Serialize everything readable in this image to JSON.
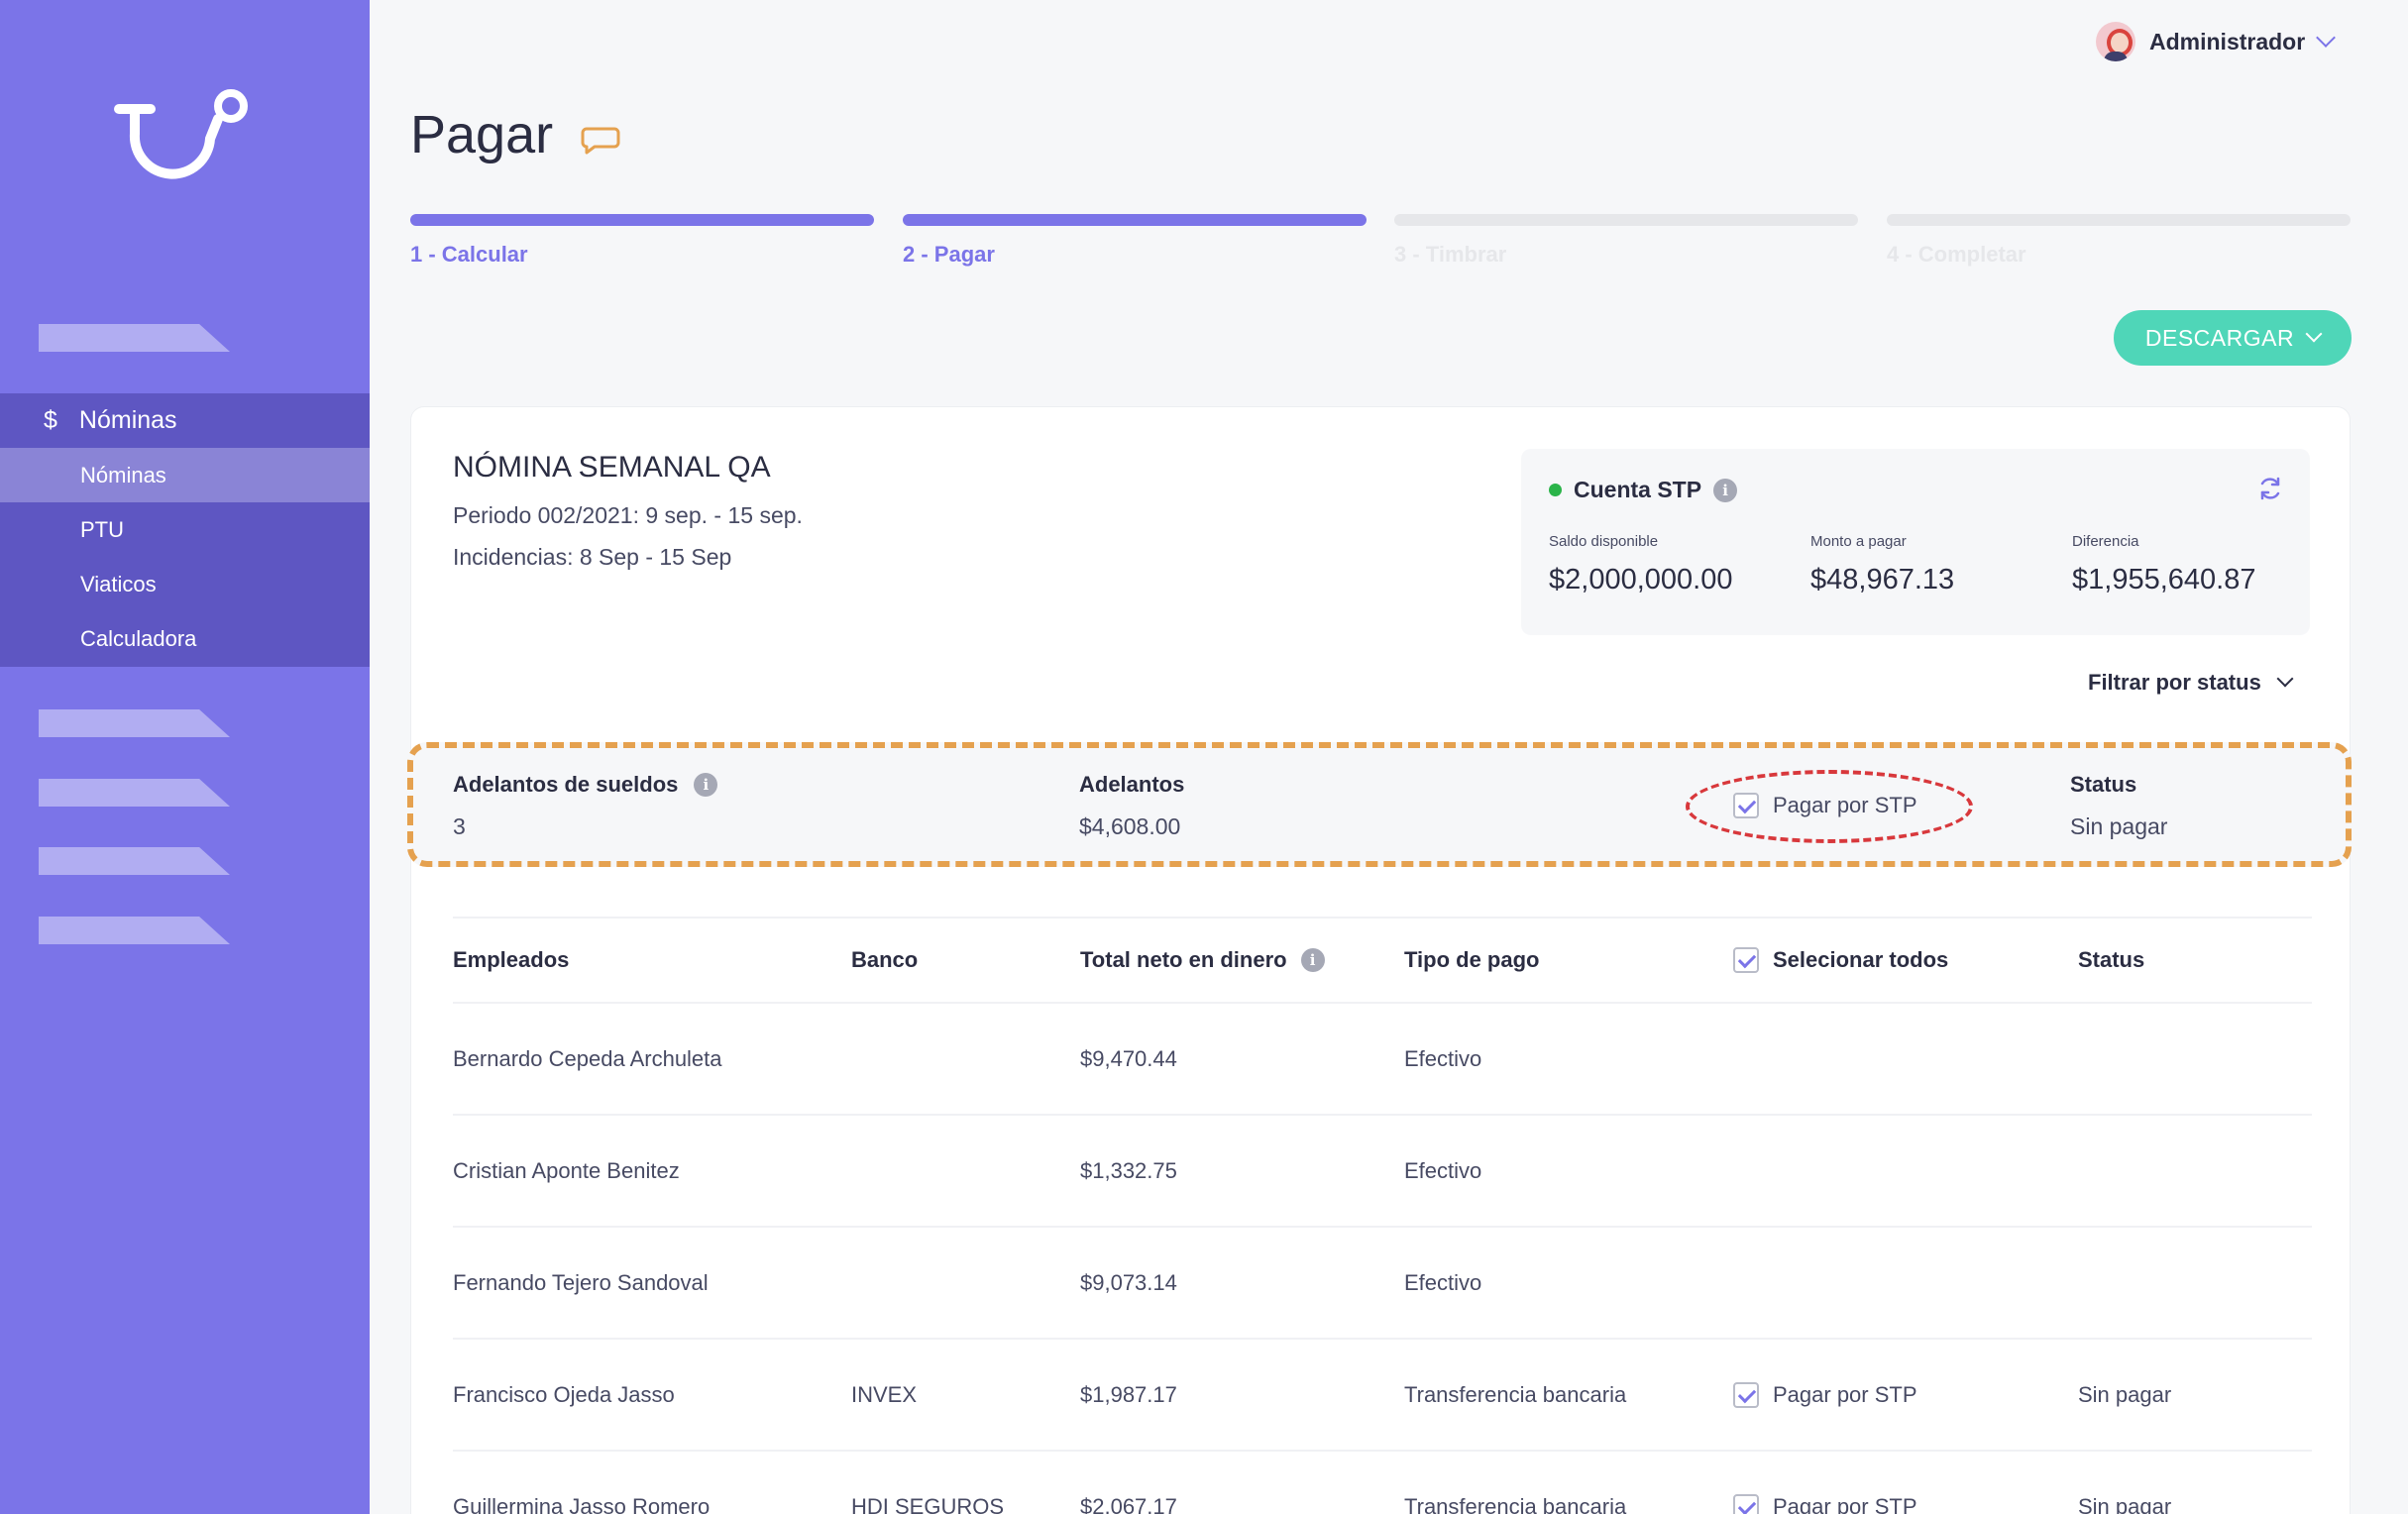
{
  "sidebar": {
    "logo_icon": "hook-logo-icon",
    "nav_parent": {
      "icon": "$",
      "label": "Nóminas"
    },
    "nav_items": [
      {
        "label": "Nóminas",
        "active": true
      },
      {
        "label": "PTU",
        "active": false
      },
      {
        "label": "Viaticos",
        "active": false
      },
      {
        "label": "Calculadora",
        "active": false
      }
    ]
  },
  "header": {
    "user_name": "Administrador",
    "page_title": "Pagar"
  },
  "stepper": [
    {
      "label": "1 - Calcular",
      "state": "done"
    },
    {
      "label": "2 - Pagar",
      "state": "done"
    },
    {
      "label": "3 - Timbrar",
      "state": "pending"
    },
    {
      "label": "4 - Completar",
      "state": "pending"
    }
  ],
  "download_label": "DESCARGAR",
  "payroll": {
    "title": "NÓMINA SEMANAL QA",
    "period": "Periodo 002/2021: 9 sep. - 15 sep.",
    "incidents": "Incidencias: 8 Sep - 15 Sep"
  },
  "stp_account": {
    "name": "Cuenta STP",
    "status_color": "#2bb44a",
    "items": [
      {
        "label": "Saldo disponible",
        "value": "$2,000,000.00"
      },
      {
        "label": "Monto a pagar",
        "value": "$48,967.13"
      },
      {
        "label": "Diferencia",
        "value": "$1,955,640.87"
      }
    ]
  },
  "filter_label": "Filtrar por status",
  "advances": {
    "label": "Adelantos de sueldos",
    "count": "3",
    "amount_label": "Adelantos",
    "amount": "$4,608.00",
    "pay_label": "Pagar por STP",
    "status_label": "Status",
    "status": "Sin pagar"
  },
  "table": {
    "headers": {
      "employees": "Empleados",
      "bank": "Banco",
      "net": "Total neto en dinero",
      "pay_type": "Tipo de pago",
      "select_all": "Selecionar todos",
      "status": "Status"
    },
    "rows": [
      {
        "name": "Bernardo Cepeda Archuleta",
        "bank": "",
        "net": "$9,470.44",
        "pay_type": "Efectivo",
        "stp": false,
        "stp_label": "",
        "status": ""
      },
      {
        "name": "Cristian Aponte Benitez",
        "bank": "",
        "net": "$1,332.75",
        "pay_type": "Efectivo",
        "stp": false,
        "stp_label": "",
        "status": ""
      },
      {
        "name": "Fernando Tejero Sandoval",
        "bank": "",
        "net": "$9,073.14",
        "pay_type": "Efectivo",
        "stp": false,
        "stp_label": "",
        "status": ""
      },
      {
        "name": "Francisco Ojeda Jasso",
        "bank": "INVEX",
        "net": "$1,987.17",
        "pay_type": "Transferencia bancaria",
        "stp": true,
        "stp_label": "Pagar por STP",
        "status": "Sin pagar"
      },
      {
        "name": "Guillermina Jasso Romero",
        "bank": "HDI SEGUROS",
        "net": "$2,067.17",
        "pay_type": "Transferencia bancaria",
        "stp": true,
        "stp_label": "Pagar por STP",
        "status": "Sin pagar"
      }
    ]
  },
  "colors": {
    "accent": "#7b74e8",
    "sidebar_active": "#5e56c2",
    "download": "#4fd6b8",
    "highlight_orange": "#e5a14f",
    "highlight_red": "#d8383c"
  }
}
